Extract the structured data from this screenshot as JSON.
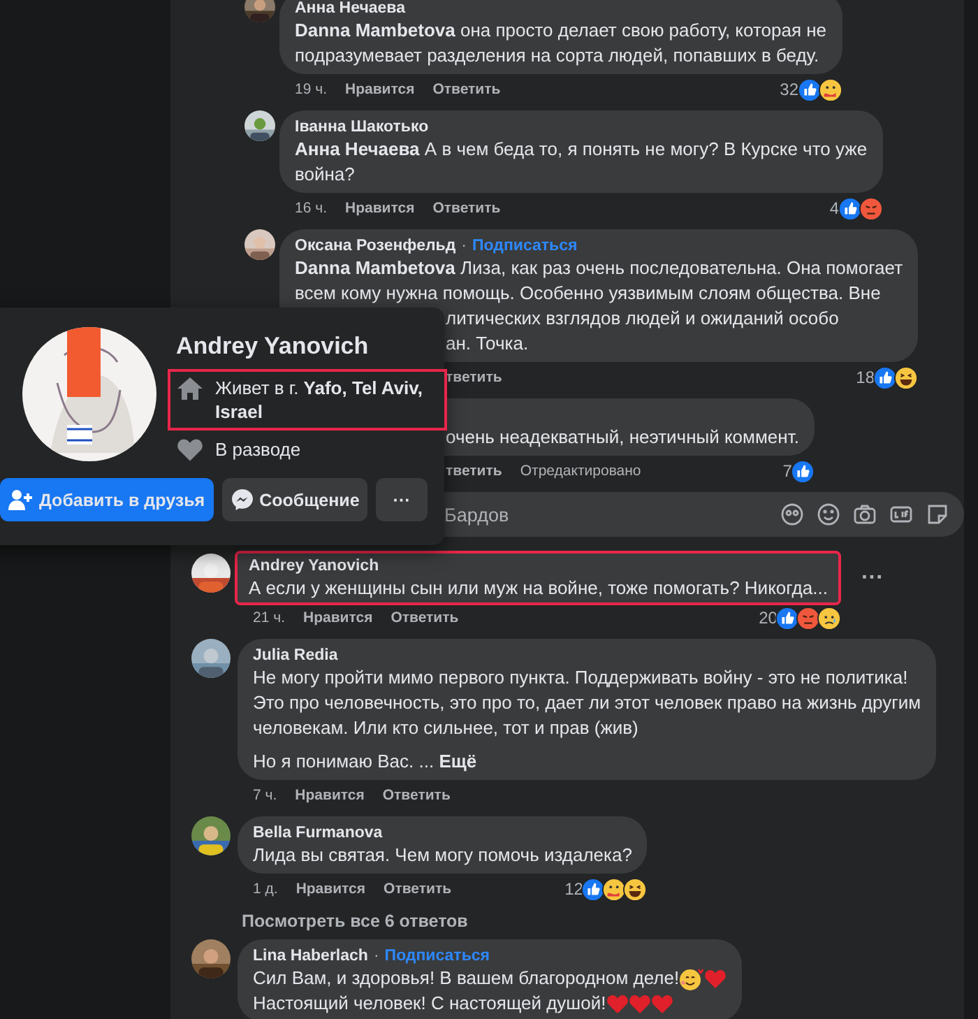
{
  "thread_replies": [
    {
      "author": "Анна Нечаева",
      "lines": [
        {
          "text": "**Danna Mambetova** она просто делает свою работу, которая не",
          "covered": false
        },
        {
          "text": "подразумевает разделения на сорта людей, попавших в беду.",
          "covered": false
        }
      ],
      "meta": [
        {
          "kind": "time",
          "text": "19 ч.",
          "covered": false
        },
        {
          "kind": "action",
          "text": "Нравится",
          "covered": false
        },
        {
          "kind": "action",
          "text": "Ответить",
          "covered": false
        }
      ],
      "count": "32",
      "reactions": [
        {
          "kind": "like"
        },
        {
          "kind": "care"
        }
      ],
      "highlighted": false,
      "author_covered": false
    },
    {
      "author": "Іванна Шакотько",
      "lines": [
        {
          "text": "**Анна Нечаева** А в чем беда то, я понять не могу? В Курске что уже",
          "covered": false
        },
        {
          "text": "война?",
          "covered": false
        }
      ],
      "meta": [
        {
          "kind": "time",
          "text": "16 ч.",
          "covered": false
        },
        {
          "kind": "action",
          "text": "Нравится",
          "covered": false
        },
        {
          "kind": "action",
          "text": "Ответить",
          "covered": false
        }
      ],
      "count": "4",
      "reactions": [
        {
          "kind": "like"
        },
        {
          "kind": "angry"
        }
      ],
      "highlighted": false,
      "author_covered": false
    },
    {
      "author": "Оксана Розенфельд",
      "follow": {
        "separator": "·",
        "text": "Подписаться"
      },
      "lines": [
        {
          "text": "**Danna Mambetova** Лиза, как раз очень последовательна. Она помогает",
          "covered": false
        },
        {
          "text": "всем кому нужна помощь. Особенно уязвимым слоям общества. Вне",
          "covered": false
        },
        {
          "text": "литических взглядов людей и ожиданий особо",
          "covered": true
        },
        {
          "text": "ан. Точка.",
          "covered": true
        }
      ],
      "meta": [
        {
          "kind": "action",
          "text": "тветить",
          "covered": true
        }
      ],
      "count": "18",
      "reactions": [
        {
          "kind": "like"
        },
        {
          "kind": "haha"
        }
      ],
      "highlighted": false,
      "author_covered": false
    },
    {
      "lines": [
        {
          "text": "очень неадекватный, неэтичный коммент.",
          "covered": true
        }
      ],
      "meta": [
        {
          "kind": "action",
          "text": "тветить",
          "covered": true
        },
        {
          "kind": "edited",
          "text": "Отредактировано",
          "covered": false
        }
      ],
      "count": "7",
      "reactions": [
        {
          "kind": "like"
        }
      ],
      "highlighted": false,
      "author_covered": true
    }
  ],
  "reply_input": {
    "placeholder": "Бардов"
  },
  "comments": [
    {
      "author": "Andrey Yanovich",
      "lines": [
        {
          "text": "А если у женщины сын или муж на войне, тоже помогать? Никогда...",
          "covered": false
        }
      ],
      "meta": [
        {
          "kind": "time",
          "text": "21 ч.",
          "covered": false
        },
        {
          "kind": "action",
          "text": "Нравится",
          "covered": false
        },
        {
          "kind": "action",
          "text": "Ответить",
          "covered": false
        }
      ],
      "count": "20",
      "reactions": [
        {
          "kind": "like"
        },
        {
          "kind": "angry"
        },
        {
          "kind": "sad"
        }
      ],
      "highlighted": true,
      "more_button": "···",
      "author_covered": false
    },
    {
      "author": "Julia Redia",
      "lines": [
        {
          "text": "Не могу пройти мимо первого пункта. Поддерживать войну - это не политика!",
          "covered": false
        },
        {
          "text": "Это про человечность, это про то, дает ли этот человек право на жизнь другим",
          "covered": false
        },
        {
          "text": "человекам. Или кто сильнее, тот и прав (жив)",
          "covered": false
        }
      ],
      "last_paragraph": "Но я понимаю Вас. ...",
      "see_more": "Ещё",
      "meta": [
        {
          "kind": "time",
          "text": "7 ч.",
          "covered": false
        },
        {
          "kind": "action",
          "text": "Нравится",
          "covered": false
        },
        {
          "kind": "action",
          "text": "Ответить",
          "covered": false
        }
      ],
      "highlighted": false,
      "author_covered": false
    },
    {
      "author": "Bella Furmanova",
      "lines": [
        {
          "text": "Лида вы святая. Чем могу помочь издалека?",
          "covered": false
        }
      ],
      "meta": [
        {
          "kind": "time",
          "text": "1 д.",
          "covered": false
        },
        {
          "kind": "action",
          "text": "Нравится",
          "covered": false
        },
        {
          "kind": "action",
          "text": "Ответить",
          "covered": false
        }
      ],
      "count": "12",
      "reactions": [
        {
          "kind": "like"
        },
        {
          "kind": "care"
        },
        {
          "kind": "haha"
        }
      ],
      "highlighted": false,
      "view_replies": "Посмотреть все 6 ответов",
      "author_covered": false
    },
    {
      "author": "Lina Haberlach",
      "follow": {
        "separator": "·",
        "text": "Подписаться"
      },
      "lines": [
        {
          "text": "Сил Вам, и здоровья! В вашем благородном деле!",
          "covered": false,
          "emoji": [
            {
              "kind": "smile_hearts"
            },
            {
              "kind": "heart"
            }
          ]
        },
        {
          "text": "Настоящий человек! С настоящей душой!",
          "covered": false,
          "emoji": [
            {
              "kind": "heart"
            },
            {
              "kind": "heart"
            },
            {
              "kind": "heart"
            }
          ]
        }
      ],
      "highlighted": false,
      "author_covered": false
    }
  ],
  "profile_card": {
    "name": "Andrey Yanovich",
    "info": [
      {
        "kind": "home",
        "text": "Живет в г. **Yafo, Tel Aviv, Israel**",
        "highlighted": true
      },
      {
        "kind": "relationship",
        "text": "В разводе",
        "highlighted": false
      }
    ],
    "buttons": [
      {
        "kind": "add_friend",
        "text": "Добавить в друзья"
      },
      {
        "kind": "message",
        "text": "Сообщение"
      },
      {
        "kind": "more",
        "text": "···"
      }
    ]
  }
}
